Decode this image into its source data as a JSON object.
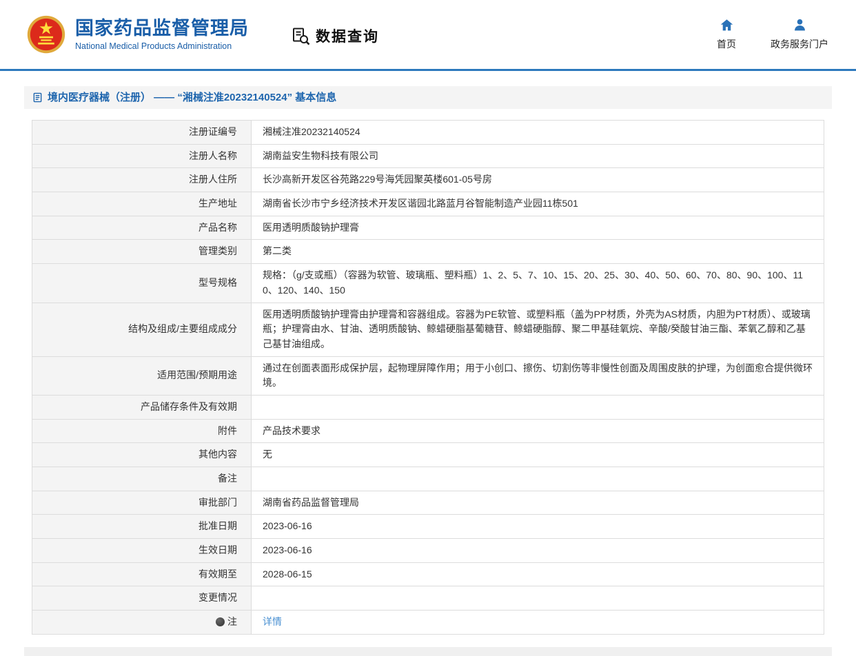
{
  "header": {
    "org_cn": "国家药品监督管理局",
    "org_en": "National Medical Products Administration",
    "search_title": "数据查询",
    "nav": [
      {
        "label": "首页"
      },
      {
        "label": "政务服务门户"
      }
    ]
  },
  "page": {
    "title": "境内医疗器械（注册） —— “湘械注准20232140524” 基本信息"
  },
  "detail": {
    "rows": [
      {
        "label": "注册证编号",
        "value": "湘械注准20232140524"
      },
      {
        "label": "注册人名称",
        "value": "湖南益安生物科技有限公司"
      },
      {
        "label": "注册人住所",
        "value": "长沙高新开发区谷苑路229号海凭园聚英楼601-05号房"
      },
      {
        "label": "生产地址",
        "value": "湖南省长沙市宁乡经济技术开发区谐园北路蓝月谷智能制造产业园11栋501"
      },
      {
        "label": "产品名称",
        "value": "医用透明质酸钠护理膏"
      },
      {
        "label": "管理类别",
        "value": "第二类"
      },
      {
        "label": "型号规格",
        "value": "规格：（g/支或瓶）（容器为软管、玻璃瓶、塑料瓶）1、2、5、7、10、15、20、25、30、40、50、60、70、80、90、100、110、120、140、150"
      },
      {
        "label": "结构及组成/主要组成成分",
        "value": "医用透明质酸钠护理膏由护理膏和容器组成。容器为PE软管、或塑料瓶（盖为PP材质，外壳为AS材质，内胆为PT材质）、或玻璃瓶；护理膏由水、甘油、透明质酸钠、鲸蜡硬脂基葡糖苷、鲸蜡硬脂醇、聚二甲基硅氧烷、辛酸/癸酸甘油三酯、苯氧乙醇和乙基己基甘油组成。"
      },
      {
        "label": "适用范围/预期用途",
        "value": "通过在创面表面形成保护层，起物理屏障作用；用于小创口、擦伤、切割伤等非慢性创面及周围皮肤的护理，为创面愈合提供微环境。"
      },
      {
        "label": "产品储存条件及有效期",
        "value": ""
      },
      {
        "label": "附件",
        "value": "产品技术要求"
      },
      {
        "label": "其他内容",
        "value": "无"
      },
      {
        "label": "备注",
        "value": ""
      },
      {
        "label": "审批部门",
        "value": "湖南省药品监督管理局"
      },
      {
        "label": "批准日期",
        "value": "2023-06-16"
      },
      {
        "label": "生效日期",
        "value": "2023-06-16"
      },
      {
        "label": "有效期至",
        "value": "2028-06-15"
      },
      {
        "label": "变更情况",
        "value": ""
      },
      {
        "label": "注",
        "value": "详情"
      }
    ]
  },
  "colors": {
    "brand_blue": "#1a5ea8",
    "rule_blue": "#2d79bd",
    "title_blue": "#1f66ae",
    "link_blue": "#4a90d2",
    "label_bg": "#f4f4f4",
    "border": "#dcdcdc"
  }
}
